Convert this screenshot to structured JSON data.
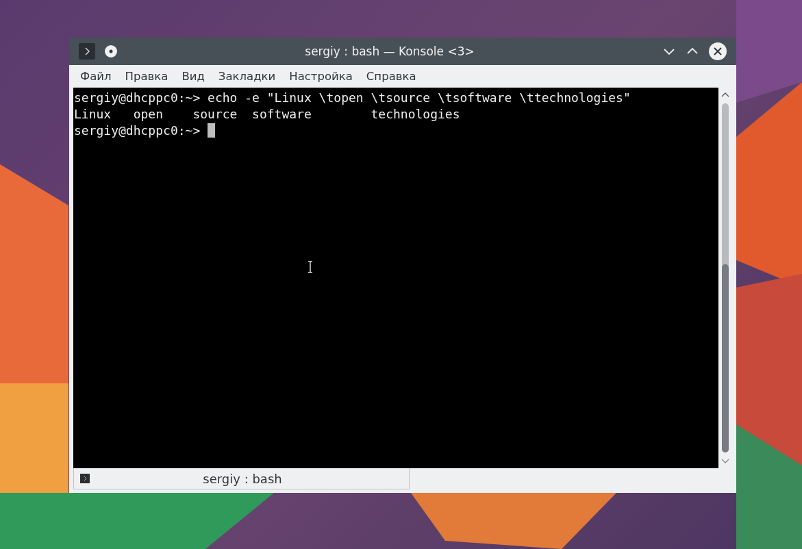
{
  "window": {
    "title": "sergiy : bash — Konsole <3>"
  },
  "menu": [
    "Файл",
    "Правка",
    "Вид",
    "Закладки",
    "Настройка",
    "Справка"
  ],
  "terminal": {
    "lines": [
      {
        "text": "sergiy@dhcppc0:~> echo -e \"Linux \\topen \\tsource \\tsoftware \\ttechnologies\"",
        "cursor": false
      },
      {
        "text": "Linux   open    source  software        technologies",
        "cursor": false
      },
      {
        "text": "sergiy@dhcppc0:~> ",
        "cursor": true
      }
    ]
  },
  "tabs": [
    {
      "label": "sergiy : bash",
      "selected": true
    }
  ]
}
